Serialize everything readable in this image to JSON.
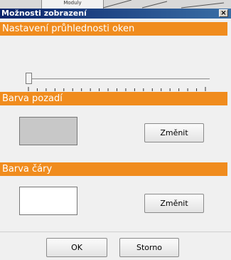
{
  "background_window": {
    "tab_label": "Moduly"
  },
  "dialog": {
    "title": "Možnosti zobrazení",
    "close_symbol": "×",
    "title_bar_color": "#0a246a",
    "header_color": "#f08c1e"
  },
  "transparency": {
    "header": "Nastavení průhlednosti oken",
    "slider_value_fraction": 0.0,
    "tick_count": 21
  },
  "background_color": {
    "header": "Barva pozadí",
    "swatch_color": "#c8c8c8",
    "change_button": "Změnit"
  },
  "line_color": {
    "header": "Barva čáry",
    "swatch_color": "#ffffff",
    "change_button": "Změnit"
  },
  "footer": {
    "ok_button": "OK",
    "cancel_button": "Storno"
  }
}
